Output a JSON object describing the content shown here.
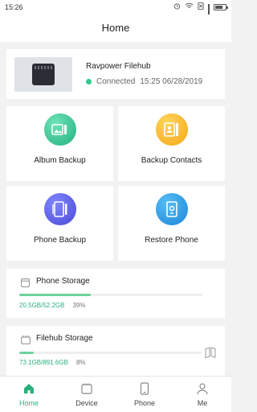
{
  "status_bar": {
    "time": "15:26"
  },
  "header": {
    "title": "Home"
  },
  "device": {
    "name": "Ravpower Filehub",
    "status": "Connected",
    "timestamp": "15:25 06/28/2019"
  },
  "actions": [
    {
      "label": "Album Backup",
      "icon": "album-icon"
    },
    {
      "label": "Backup Contacts",
      "icon": "contacts-icon"
    },
    {
      "label": "Phone Backup",
      "icon": "phone-backup-icon"
    },
    {
      "label": "Restore Phone",
      "icon": "restore-icon"
    }
  ],
  "phone_storage": {
    "title": "Phone Storage",
    "usage": "20.5GB/52.2GB",
    "percent": "39%",
    "fraction": 0.39
  },
  "filehub_storage": {
    "title": "Filehub Storage",
    "usage": "73.1GB/891.6GB",
    "percent": "8%",
    "fraction": 0.08
  },
  "tabs": [
    {
      "label": "Home",
      "active": true
    },
    {
      "label": "Device",
      "active": false
    },
    {
      "label": "Phone",
      "active": false
    },
    {
      "label": "Me",
      "active": false
    }
  ],
  "colors": {
    "accent": "#2ab07a",
    "progress": "#6ed39a",
    "connected": "#2ecc8e"
  }
}
